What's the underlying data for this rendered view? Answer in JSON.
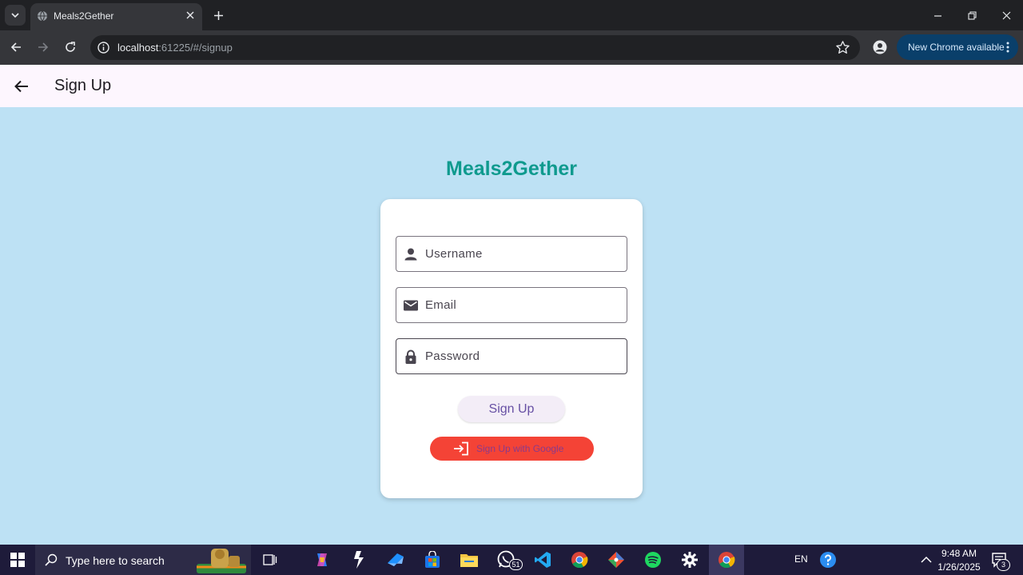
{
  "browser": {
    "tab": {
      "title": "Meals2Gether",
      "favicon": "globe-icon"
    },
    "address": {
      "host": "localhost",
      "path": ":61225/#/signup"
    },
    "update_button_label": "New Chrome available"
  },
  "app_bar": {
    "title": "Sign Up",
    "back_icon": "arrow-back-icon"
  },
  "main": {
    "brand_title": "Meals2Gether",
    "form": {
      "username": {
        "placeholder": "Username",
        "icon": "person-icon",
        "value": ""
      },
      "email": {
        "placeholder": "Email",
        "icon": "mail-icon",
        "value": ""
      },
      "password": {
        "placeholder": "Password",
        "icon": "lock-icon",
        "value": ""
      },
      "signup_label": "Sign Up",
      "google_label": "Sign Up with Google",
      "google_icon": "login-icon"
    }
  },
  "taskbar": {
    "search_placeholder": "Type here to search",
    "apps": [
      "task-view",
      "copilot",
      "dev-tool",
      "azure-data-studio",
      "microsoft-store",
      "file-explorer",
      "whatsapp",
      "vs-code",
      "chrome",
      "git",
      "spotify",
      "settings",
      "chrome-active"
    ],
    "whatsapp_badge": "51",
    "language": "EN",
    "time": "9:48 AM",
    "date": "1/26/2025",
    "notification_count": "3"
  },
  "colors": {
    "page_background": "#bde1f4",
    "brand": "#0f9a8e",
    "google_button": "#f44336",
    "primary_text": "#6750a4"
  }
}
